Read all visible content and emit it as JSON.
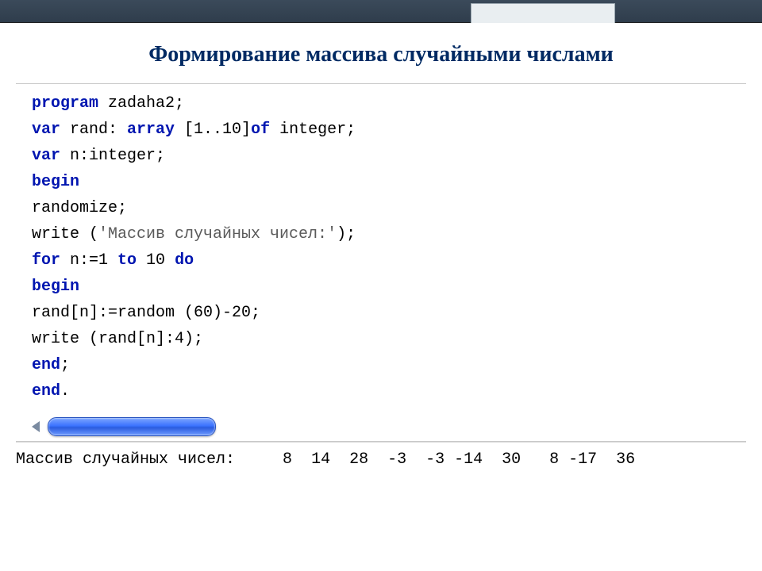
{
  "title": "Формирование массива случайными числами",
  "code": {
    "l1_kw": "program",
    "l1_rest": " zadaha2;",
    "l2_kw1": "var",
    "l2_mid": " rand: ",
    "l2_kw2": "array",
    "l2_rest": " [1..10]",
    "l2_kw3": "of",
    "l2_rest2": " integer;",
    "l3_kw": "var",
    "l3_rest": " n:integer;",
    "l4": "begin",
    "l5": "randomize;",
    "l6_a": "write (",
    "l6_str": "'Массив случайных чисел:'",
    "l6_b": ");",
    "l7_kw1": "for",
    "l7_mid1": " n:=1 ",
    "l7_kw2": "to",
    "l7_mid2": " 10 ",
    "l7_kw3": "do",
    "l8": "begin",
    "l9": "rand[n]:=random (60)-20;",
    "l10": "write (rand[n]:4);",
    "l11": "end",
    "l11_semi": ";",
    "l12": "end",
    "l12_dot": "."
  },
  "output": {
    "label": "Массив случайных чисел:",
    "values": [
      8,
      14,
      28,
      -3,
      -3,
      -14,
      30,
      8,
      -17,
      36
    ]
  }
}
